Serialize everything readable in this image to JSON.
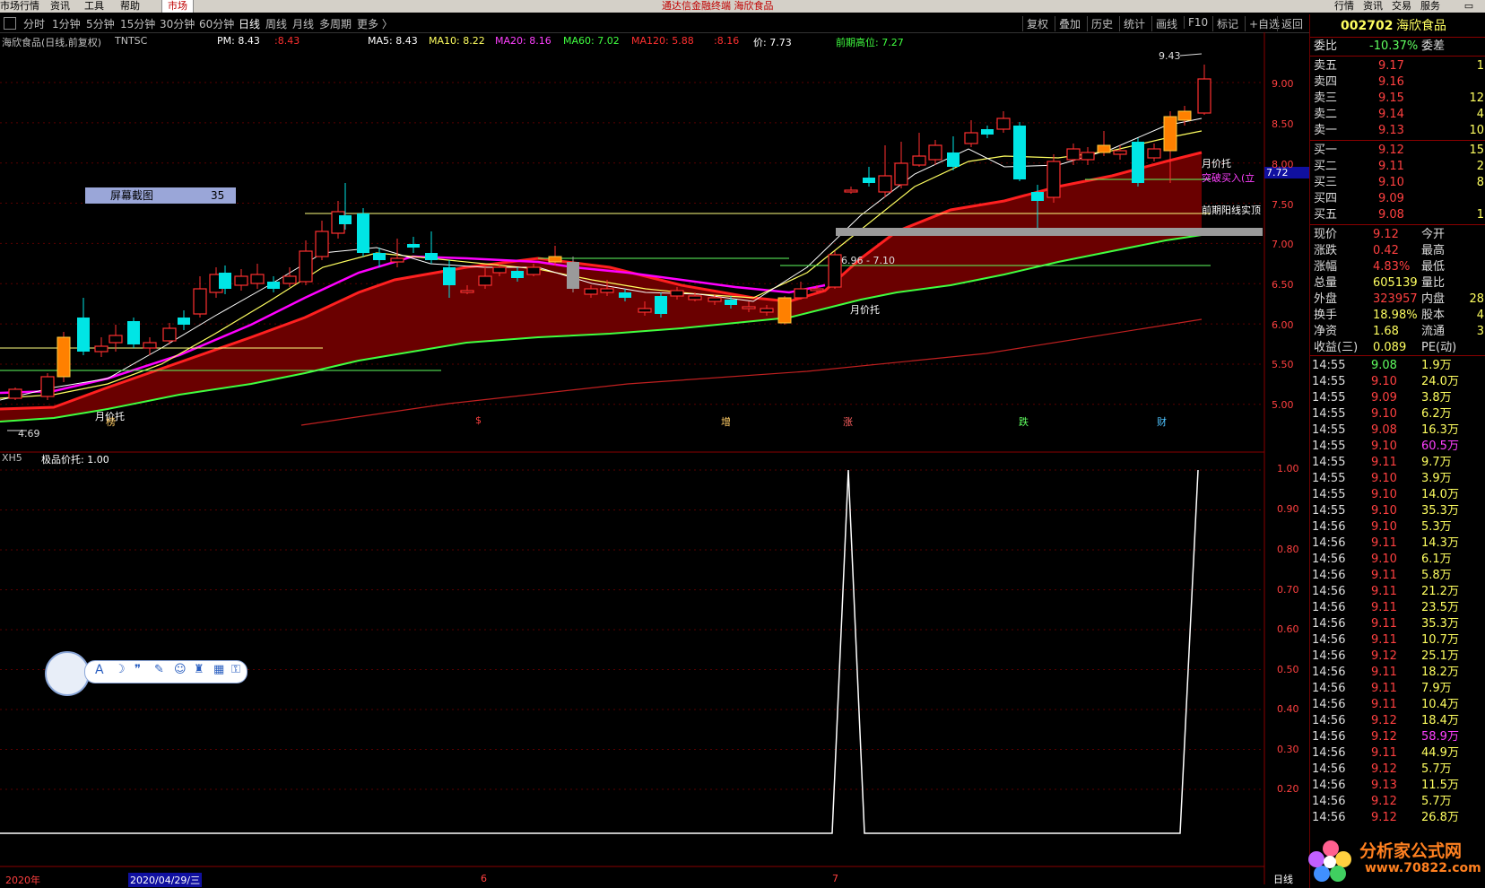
{
  "menu": {
    "items": [
      "市场行情",
      "资讯",
      "工具",
      "帮助"
    ],
    "market_tab": "市场",
    "app_title": "通达信金融终端  海欣食品",
    "right_items": [
      "行情",
      "资讯",
      "交易",
      "服务"
    ]
  },
  "toolbar": {
    "periods": [
      "分时",
      "1分钟",
      "5分钟",
      "15分钟",
      "30分钟",
      "60分钟",
      "日线",
      "周线",
      "月线",
      "多周期",
      "更多 〉"
    ],
    "active": "日线",
    "tools": [
      "复权",
      "叠加",
      "历史",
      "统计",
      "画线",
      "F10",
      "标记",
      "+自选",
      "返回"
    ]
  },
  "main_chart": {
    "title": "海欣食品(日线,前复权)",
    "indicator": "TNTSC",
    "pm": "PM: 8.43",
    "pm2": ":8.43",
    "ma5": "MA5: 8.43",
    "ma10": "MA10: 8.22",
    "ma20": "MA20: 8.16",
    "ma60": "MA60: 7.02",
    "ma120": "MA120: 5.88",
    "ma_extra": ":8.16",
    "price": "价: 7.73",
    "prev_high": "前期高位: 7.27",
    "y_ticks": [
      "9.00",
      "8.50",
      "8.00",
      "7.50",
      "7.00",
      "6.50",
      "6.00",
      "5.50",
      "5.00"
    ],
    "annotations": {
      "high": "9.43",
      "low": "4.69",
      "range": "6.96 - 7.10",
      "monthly_support_1": "月价托",
      "monthly_support_2": "月价托",
      "monthly_support_3": "月价托",
      "breakout_buy": "突破买入(立",
      "breakout_price": "7.72",
      "prev_yang": "前期阳线实顶",
      "screenshot_label": "屏幕截图",
      "screenshot_count": "35"
    },
    "event_markers": [
      "榜",
      "$",
      "增",
      "涨",
      "跌",
      "财"
    ],
    "colors": {
      "up": "#ff3030",
      "down": "#00e5e5",
      "ma5": "#ffffff",
      "ma10": "#ffff60",
      "ma20": "#ff00ff",
      "ma60": "#40ff40",
      "ma120": "#ff3030"
    }
  },
  "sub_chart": {
    "title": "XH5",
    "indicator_name": "极品价托: 1.00",
    "y_ticks": [
      "1.00",
      "0.90",
      "0.80",
      "0.70",
      "0.60",
      "0.50",
      "0.40",
      "0.30",
      "0.20"
    ]
  },
  "date_axis": {
    "year": "2020年",
    "cursor_date": "2020/04/29/三",
    "month_6": "6",
    "month_7": "7",
    "period_label": "日线"
  },
  "quote": {
    "code": "002702",
    "name": "海欣食品",
    "weibi_label": "委比",
    "weibi_value": "-10.37%",
    "weicha_label": "委差",
    "asks": [
      {
        "label": "卖五",
        "price": "9.17",
        "vol": "1"
      },
      {
        "label": "卖四",
        "price": "9.16",
        "vol": ""
      },
      {
        "label": "卖三",
        "price": "9.15",
        "vol": "12"
      },
      {
        "label": "卖二",
        "price": "9.14",
        "vol": "4"
      },
      {
        "label": "卖一",
        "price": "9.13",
        "vol": "10"
      }
    ],
    "bids": [
      {
        "label": "买一",
        "price": "9.12",
        "vol": "15"
      },
      {
        "label": "买二",
        "price": "9.11",
        "vol": "2"
      },
      {
        "label": "买三",
        "price": "9.10",
        "vol": "8"
      },
      {
        "label": "买四",
        "price": "9.09",
        "vol": ""
      },
      {
        "label": "买五",
        "price": "9.08",
        "vol": "1"
      }
    ],
    "stats": [
      {
        "l1": "现价",
        "v1": "9.12",
        "l2": "今开"
      },
      {
        "l1": "涨跌",
        "v1": "0.42",
        "l2": "最高"
      },
      {
        "l1": "涨幅",
        "v1": "4.83%",
        "l2": "最低"
      },
      {
        "l1": "总量",
        "v1": "605139",
        "l2": "量比"
      },
      {
        "l1": "外盘",
        "v1": "323957",
        "l2": "内盘",
        "v2": "28"
      },
      {
        "l1": "换手",
        "v1": "18.98%",
        "l2": "股本",
        "v2": "4"
      },
      {
        "l1": "净资",
        "v1": "1.68",
        "l2": "流通",
        "v2": "3"
      },
      {
        "l1": "收益(三)",
        "v1": "0.089",
        "l2": "PE(动)"
      }
    ],
    "ticks": [
      {
        "t": "14:55",
        "p": "9.08",
        "v": "1.9万",
        "c": "down"
      },
      {
        "t": "14:55",
        "p": "9.10",
        "v": "24.0万",
        "c": "up"
      },
      {
        "t": "14:55",
        "p": "9.09",
        "v": "3.8万",
        "c": "up"
      },
      {
        "t": "14:55",
        "p": "9.10",
        "v": "6.2万",
        "c": "up"
      },
      {
        "t": "14:55",
        "p": "9.08",
        "v": "16.3万",
        "c": "up"
      },
      {
        "t": "14:55",
        "p": "9.10",
        "v": "60.5万",
        "c": "big"
      },
      {
        "t": "14:55",
        "p": "9.11",
        "v": "9.7万",
        "c": "up"
      },
      {
        "t": "14:55",
        "p": "9.10",
        "v": "3.9万",
        "c": "up"
      },
      {
        "t": "14:55",
        "p": "9.10",
        "v": "14.0万",
        "c": "up"
      },
      {
        "t": "14:55",
        "p": "9.10",
        "v": "35.3万",
        "c": "up"
      },
      {
        "t": "14:56",
        "p": "9.10",
        "v": "5.3万",
        "c": "up"
      },
      {
        "t": "14:56",
        "p": "9.11",
        "v": "14.3万",
        "c": "up"
      },
      {
        "t": "14:56",
        "p": "9.10",
        "v": "6.1万",
        "c": "up"
      },
      {
        "t": "14:56",
        "p": "9.11",
        "v": "5.8万",
        "c": "up"
      },
      {
        "t": "14:56",
        "p": "9.11",
        "v": "21.2万",
        "c": "up"
      },
      {
        "t": "14:56",
        "p": "9.11",
        "v": "23.5万",
        "c": "up"
      },
      {
        "t": "14:56",
        "p": "9.11",
        "v": "35.3万",
        "c": "up"
      },
      {
        "t": "14:56",
        "p": "9.11",
        "v": "10.7万",
        "c": "up"
      },
      {
        "t": "14:56",
        "p": "9.12",
        "v": "25.1万",
        "c": "up"
      },
      {
        "t": "14:56",
        "p": "9.11",
        "v": "18.2万",
        "c": "up"
      },
      {
        "t": "14:56",
        "p": "9.11",
        "v": "7.9万",
        "c": "up"
      },
      {
        "t": "14:56",
        "p": "9.11",
        "v": "10.4万",
        "c": "up"
      },
      {
        "t": "14:56",
        "p": "9.12",
        "v": "18.4万",
        "c": "up"
      },
      {
        "t": "14:56",
        "p": "9.12",
        "v": "58.9万",
        "c": "big"
      },
      {
        "t": "14:56",
        "p": "9.11",
        "v": "44.9万",
        "c": "up"
      },
      {
        "t": "14:56",
        "p": "9.12",
        "v": "5.7万",
        "c": "up"
      },
      {
        "t": "14:56",
        "p": "9.13",
        "v": "11.5万",
        "c": "up"
      },
      {
        "t": "14:56",
        "p": "9.12",
        "v": "5.7万",
        "c": "up"
      },
      {
        "t": "14:56",
        "p": "9.12",
        "v": "26.8万",
        "c": "up"
      }
    ]
  },
  "watermark": {
    "title": "分析家公式网",
    "url": "www.70822.com"
  },
  "floating_toolbar": {
    "icons": [
      "font-icon",
      "moon-icon",
      "quote-icon",
      "wrench-icon",
      "smile-icon",
      "shirt-icon",
      "grid-icon",
      "lock-icon"
    ]
  }
}
